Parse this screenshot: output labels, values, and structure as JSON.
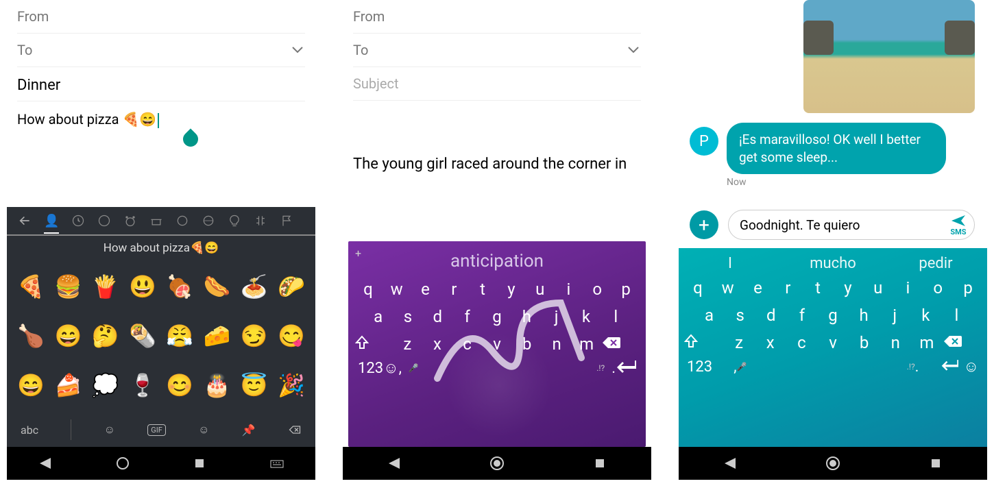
{
  "screen1": {
    "from_label": "From",
    "to_label": "To",
    "subject": "Dinner",
    "body_text": "How about pizza 🍕😄",
    "kb_hint": "How about pizza🍕😄",
    "emoji_categories": [
      "back",
      "recent",
      "face",
      "animal",
      "food",
      "activity",
      "travel",
      "object",
      "symbol",
      "flag"
    ],
    "emojis": [
      "🍕",
      "🍔",
      "🍟",
      "😃",
      "🍖",
      "🌭",
      "🍝",
      "🌮",
      "🍗",
      "😄",
      "🤔",
      "🌯",
      "😤",
      "🧀",
      "😏",
      "😋",
      "😄",
      "🍰",
      "💭",
      "🍷",
      "😊",
      "🎂",
      "😇",
      "🎉"
    ],
    "abc_label": "abc",
    "bottom_icons": [
      "emoji",
      "gif",
      "sticker",
      "pin",
      "backspace"
    ]
  },
  "screen2": {
    "from_label": "From",
    "to_label": "To",
    "subject_placeholder": "Subject",
    "body_text": "The young girl raced around the corner in",
    "suggestion": "anticipation",
    "row1": [
      "q",
      "w",
      "e",
      "r",
      "t",
      "y",
      "u",
      "i",
      "o",
      "p"
    ],
    "row2": [
      "a",
      "s",
      "d",
      "f",
      "g",
      "h",
      "j",
      "k",
      "l"
    ],
    "row3": [
      "z",
      "x",
      "c",
      "v",
      "b",
      "n",
      "m"
    ],
    "numkey": "123",
    "comma": ",",
    "period": ".",
    "punct_hint": ".!?"
  },
  "screen3": {
    "avatar_initial": "P",
    "bubble_text": "¡Es maravilloso! OK well I better get some sleep...",
    "timestamp": "Now",
    "input_value": "Goodnight. Te quiero",
    "sms_label": "SMS",
    "suggestions": [
      "I",
      "mucho",
      "pedir"
    ],
    "row1": [
      "q",
      "w",
      "e",
      "r",
      "t",
      "y",
      "u",
      "i",
      "o",
      "p"
    ],
    "row2": [
      "a",
      "s",
      "d",
      "f",
      "g",
      "h",
      "j",
      "k",
      "l"
    ],
    "row3": [
      "z",
      "x",
      "c",
      "v",
      "b",
      "n",
      "m"
    ],
    "numkey": "123",
    "comma": ",",
    "period": ".",
    "punct_hint": ".!?"
  },
  "colors": {
    "teal": "#009aa5",
    "purple": "#6a2a94"
  }
}
